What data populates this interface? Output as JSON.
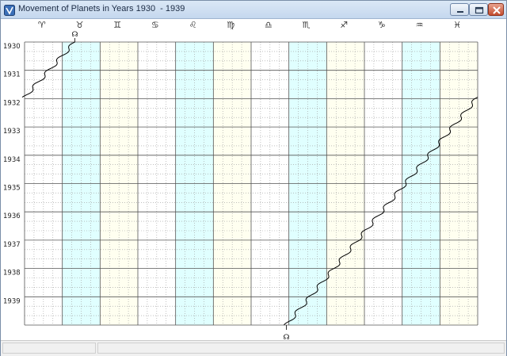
{
  "window": {
    "title": "Movement of Planets in Years 1930  - 1939"
  },
  "colors": {
    "cyan": "#e0ffff",
    "cream": "#fffff0",
    "white": "#ffffff",
    "grid_major": "#555555",
    "grid_minor": "#9a9a9a",
    "path": "#000000"
  },
  "chart_data": {
    "type": "line",
    "x_ticks": [
      "♈",
      "♉",
      "♊",
      "♋",
      "♌",
      "♍",
      "♎",
      "♏",
      "♐",
      "♑",
      "♒",
      "♓"
    ],
    "x_unit": "zodiac sign (30° each, 0–360° longitude)",
    "xlim": [
      0,
      360
    ],
    "y_ticks": [
      "1930",
      "1931",
      "1932",
      "1933",
      "1934",
      "1935",
      "1936",
      "1937",
      "1938",
      "1939"
    ],
    "ylim": [
      1930,
      1940
    ],
    "sign_fills": [
      "white",
      "cyan",
      "cream",
      "white",
      "cyan",
      "cream",
      "white",
      "cyan",
      "cream",
      "white",
      "cyan",
      "cream"
    ],
    "series": [
      {
        "glyph": "☊",
        "start_label": "☊",
        "end_label": "☊",
        "motion": "retrograde",
        "points": [
          {
            "year": 1930.0,
            "lon": 40.0
          },
          {
            "year": 1931.95,
            "lon": 0.0
          },
          {
            "year": 1931.95,
            "lon": 360.0
          },
          {
            "year": 1940.0,
            "lon": 208.0
          }
        ]
      }
    ]
  }
}
